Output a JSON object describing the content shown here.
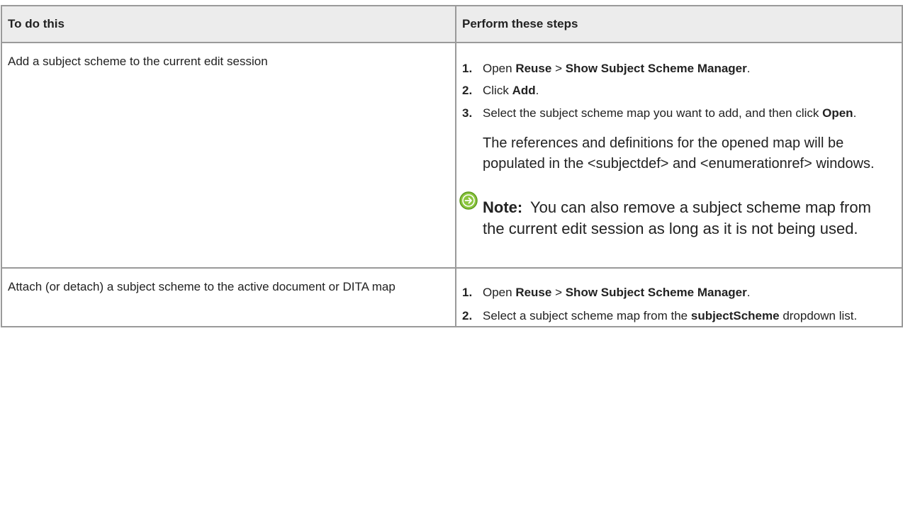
{
  "table": {
    "headers": [
      "To do this",
      "Perform these steps"
    ],
    "rows": [
      {
        "task": "Add a subject scheme to the current edit session",
        "steps": [
          {
            "num": "1.",
            "parts": [
              "Open ",
              "Reuse",
              " > ",
              "Show Subject Scheme Manager",
              "."
            ]
          },
          {
            "num": "2.",
            "parts": [
              "Click ",
              "Add",
              "."
            ]
          },
          {
            "num": "3.",
            "parts": [
              "Select the subject scheme map you want to add, and then click ",
              "Open",
              "."
            ]
          }
        ],
        "info": "The references and definitions for the opened map will be populated in the <subjectdef> and <enumerationref> windows.",
        "note": {
          "label": "Note:",
          "text": "You can also remove a subject scheme map from the current edit session as long as it is not being used.",
          "icon": "green-arrow-circle-icon"
        }
      },
      {
        "task": "Attach (or detach) a subject scheme to the active document or DITA map",
        "steps": [
          {
            "num": "1.",
            "parts": [
              "Open ",
              "Reuse",
              " > ",
              "Show Subject Scheme Manager",
              "."
            ]
          },
          {
            "num": "2.",
            "parts": [
              "Select a subject scheme map from the ",
              "subjectScheme",
              " dropdown list."
            ]
          }
        ]
      }
    ]
  },
  "colors": {
    "border": "#9a9a9a",
    "header_bg": "#ececec",
    "text": "#222222",
    "note_icon": "#8cc63f"
  }
}
